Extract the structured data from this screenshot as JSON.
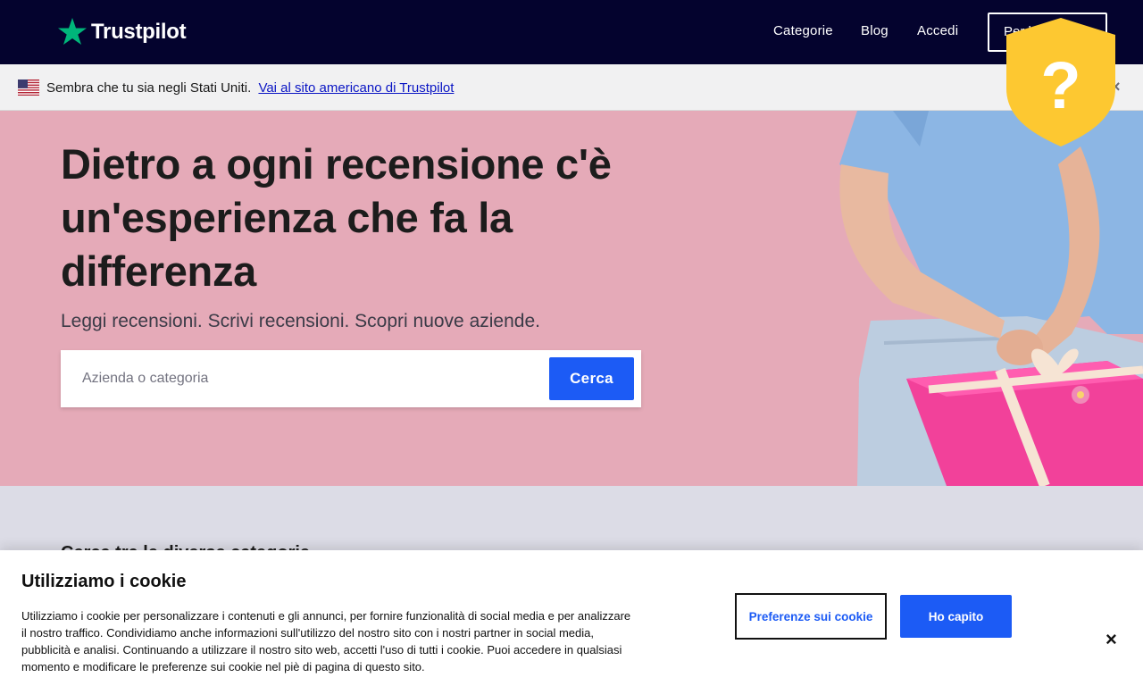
{
  "header": {
    "brand": "Trustpilot",
    "nav": {
      "categories": "Categorie",
      "blog": "Blog",
      "login": "Accedi",
      "business": "Per le aziende"
    }
  },
  "locale_bar": {
    "message": "Sembra che tu sia negli Stati Uniti.",
    "link": "Vai al sito americano di Trustpilot",
    "close": "×",
    "flag_icon": "us-flag-icon"
  },
  "hero": {
    "title": "Dietro a ogni recensione c'è un'esperienza che fa la differenza",
    "subtitle": "Leggi recensioni. Scrivi recensioni. Scopri nuove aziende.",
    "search": {
      "placeholder": "Azienda o categoria",
      "value": "",
      "button": "Cerca"
    },
    "background_color": "#e5aab8"
  },
  "below_section": {
    "heading": "Cerca tra le diverse categorie"
  },
  "badge": {
    "icon": "question-shield-icon",
    "symbol": "?",
    "color": "#fdc831"
  },
  "cookie_banner": {
    "title": "Utilizziamo i cookie",
    "body": "Utilizziamo i cookie per personalizzare i contenuti e gli annunci, per fornire funzionalità di social media e per analizzare il nostro traffico. Condividiamo anche informazioni sull'utilizzo del nostro sito con i nostri partner in social media, pubblicità e analisi. Continuando a utilizzare il nostro sito web, accetti l'uso di tutti i cookie. Puoi accedere in qualsiasi momento e modificare le preferenze sui cookie nel piè di pagina di questo sito.",
    "preferences_button": "Preferenze sui cookie",
    "accept_button": "Ho capito",
    "close": "×"
  },
  "colors": {
    "header_bg": "#04032e",
    "brand_green": "#00b67a",
    "primary_blue": "#1c5bf5",
    "link_blue": "#0a15c4"
  }
}
